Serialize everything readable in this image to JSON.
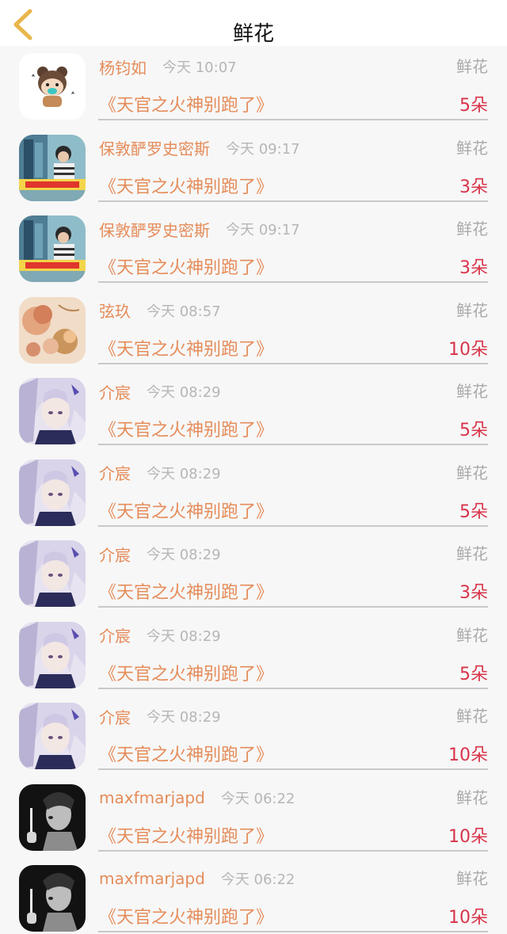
{
  "header": {
    "title": "鲜花",
    "back_icon": "chevron-left-icon",
    "back_color": "#e8b64a"
  },
  "colors": {
    "name": "#e58c5a",
    "book": "#e58c5a",
    "count": "#d8344a",
    "time": "#b6b6b6",
    "category": "#aaaaaa"
  },
  "records": [
    {
      "name": "杨钧如",
      "time": "今天 10:07",
      "category": "鲜花",
      "book": "《天官之火神别跑了》",
      "count": "5朵",
      "avatar": "cartoon-bear-avatar"
    },
    {
      "name": "保敦酽罗史密斯",
      "time": "今天 09:17",
      "category": "鲜花",
      "book": "《天官之火神别跑了》",
      "count": "3朵",
      "avatar": "photo-avatar"
    },
    {
      "name": "保敦酽罗史密斯",
      "time": "今天 09:17",
      "category": "鲜花",
      "book": "《天官之火神别跑了》",
      "count": "3朵",
      "avatar": "photo-avatar"
    },
    {
      "name": "弦玖",
      "time": "今天 08:57",
      "category": "鲜花",
      "book": "《天官之火神别跑了》",
      "count": "10朵",
      "avatar": "flower-art-avatar"
    },
    {
      "name": "介宸",
      "time": "今天 08:29",
      "category": "鲜花",
      "book": "《天官之火神别跑了》",
      "count": "5朵",
      "avatar": "anime-avatar"
    },
    {
      "name": "介宸",
      "time": "今天 08:29",
      "category": "鲜花",
      "book": "《天官之火神别跑了》",
      "count": "5朵",
      "avatar": "anime-avatar"
    },
    {
      "name": "介宸",
      "time": "今天 08:29",
      "category": "鲜花",
      "book": "《天官之火神别跑了》",
      "count": "3朵",
      "avatar": "anime-avatar"
    },
    {
      "name": "介宸",
      "time": "今天 08:29",
      "category": "鲜花",
      "book": "《天官之火神别跑了》",
      "count": "5朵",
      "avatar": "anime-avatar"
    },
    {
      "name": "介宸",
      "time": "今天 08:29",
      "category": "鲜花",
      "book": "《天官之火神别跑了》",
      "count": "10朵",
      "avatar": "anime-avatar"
    },
    {
      "name": "maxfmarjapd",
      "time": "今天 06:22",
      "category": "鲜花",
      "book": "《天官之火神别跑了》",
      "count": "10朵",
      "avatar": "monochrome-avatar"
    },
    {
      "name": "maxfmarjapd",
      "time": "今天 06:22",
      "category": "鲜花",
      "book": "《天官之火神别跑了》",
      "count": "10朵",
      "avatar": "monochrome-avatar"
    }
  ]
}
